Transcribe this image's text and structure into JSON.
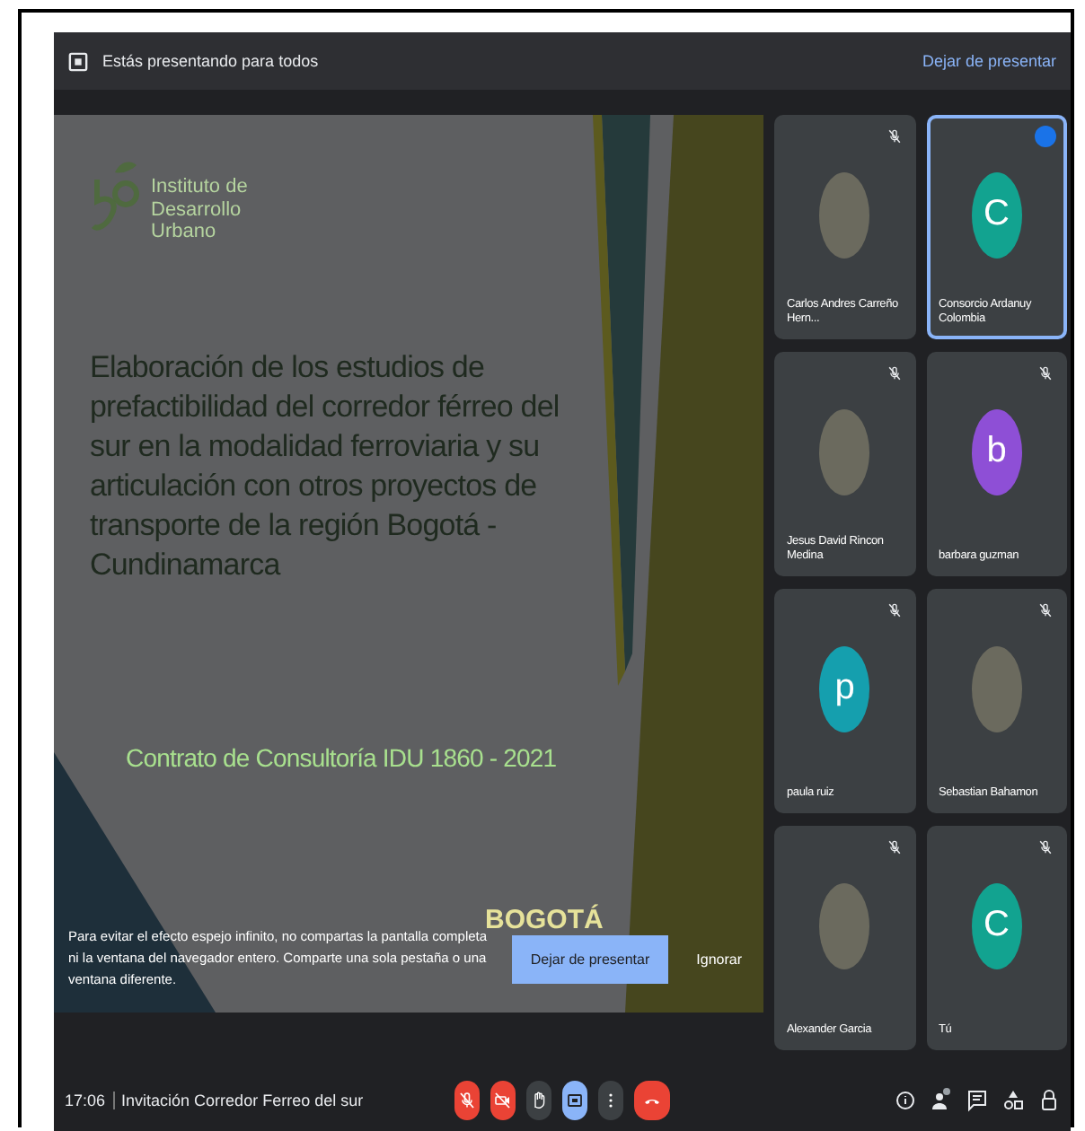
{
  "top_bar": {
    "message": "Estás presentando para todos",
    "stop_link": "Dejar de presentar"
  },
  "slide": {
    "logo_text": "Instituto de Desarrollo Urbano",
    "title": "Elaboración de los estudios de prefactibilidad del corredor férreo del sur en la modalidad ferroviaria y su articulación con otros proyectos de transporte de la región Bogotá - Cundinamarca",
    "subtitle": "Contrato de Consultoría IDU 1860 - 2021",
    "footer_logo": "BOGOTÁ"
  },
  "notice": {
    "text": "Para evitar el efecto espejo infinito, no compartas la pantalla completa ni la ventana del navegador entero. Comparte una sola pestaña o una ventana diferente.",
    "primary_button": "Dejar de presentar",
    "secondary_button": "Ignorar"
  },
  "participants": [
    {
      "name": "Carlos Andres Carreño Hern...",
      "kind": "photo",
      "muted": true,
      "speaking": false
    },
    {
      "name": "Consorcio Ardanuy Colombia",
      "kind": "letter",
      "letter": "C",
      "color": "#12a390",
      "muted": false,
      "speaking": true
    },
    {
      "name": "Jesus David Rincon Medina",
      "kind": "photo",
      "muted": true,
      "speaking": false
    },
    {
      "name": "barbara guzman",
      "kind": "letter",
      "letter": "b",
      "color": "#8e4fd6",
      "muted": true,
      "speaking": false
    },
    {
      "name": "paula ruiz",
      "kind": "letter",
      "letter": "p",
      "color": "#159fae",
      "muted": true,
      "speaking": false
    },
    {
      "name": "Sebastian Bahamon",
      "kind": "photo",
      "muted": true,
      "speaking": false
    },
    {
      "name": "Alexander Garcia",
      "kind": "photo",
      "muted": true,
      "speaking": false
    },
    {
      "name": "Tú",
      "kind": "letter",
      "letter": "C",
      "color": "#12a390",
      "muted": true,
      "speaking": false
    }
  ],
  "bottom_bar": {
    "time": "17:06",
    "meeting_title": "Invitación Corredor Ferreo del sur",
    "controls": [
      {
        "kind": "mic",
        "on": false
      },
      {
        "kind": "camera",
        "on": false
      },
      {
        "kind": "hand",
        "on": false
      },
      {
        "kind": "present",
        "on": true
      },
      {
        "kind": "more",
        "on": false
      },
      {
        "kind": "hangup",
        "on": true
      }
    ],
    "side_icons": [
      {
        "kind": "info"
      },
      {
        "kind": "people"
      },
      {
        "kind": "chat"
      },
      {
        "kind": "activities"
      },
      {
        "kind": "lock"
      }
    ]
  }
}
